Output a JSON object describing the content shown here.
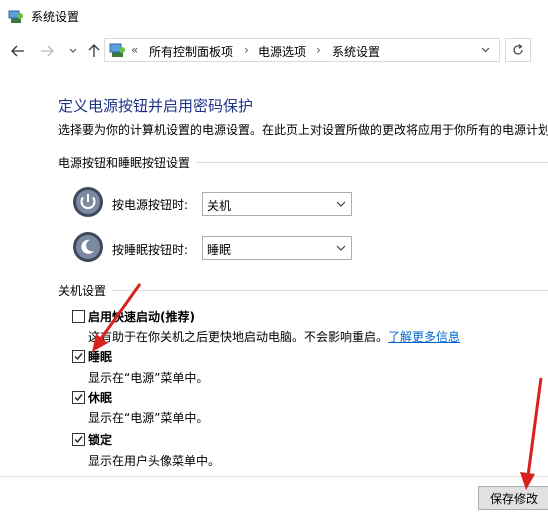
{
  "window": {
    "title": "系统设置"
  },
  "nav": {
    "back_icon": "back-arrow-icon",
    "forward_icon": "forward-arrow-icon",
    "recent_icon": "chevron-down-icon",
    "up_icon": "up-arrow-icon",
    "breadcrumb_prefix": "«",
    "breadcrumbs": [
      "所有控制面板项",
      "电源选项",
      "系统设置"
    ],
    "separator": "›",
    "refresh_icon": "refresh-icon"
  },
  "main": {
    "heading": "定义电源按钮并启用密码保护",
    "description": "选择要为你的计算机设置的电源设置。在此页上对设置所做的更改将应用于你所有的电源计划",
    "buttons_section": {
      "title": "电源按钮和睡眠按钮设置",
      "power_label": "按电源按钮时:",
      "power_value": "关机",
      "sleep_label": "按睡眠按钮时:",
      "sleep_value": "睡眠"
    },
    "shutdown_section": {
      "title": "关机设置",
      "items": [
        {
          "label": "启用快速启动(推荐)",
          "checked": false,
          "desc_text": "这有助于在你关机之后更快地启动电脑。不会影响重启。",
          "desc_link": "了解更多信息"
        },
        {
          "label": "睡眠",
          "checked": true,
          "desc_text": "显示在“电源”菜单中。"
        },
        {
          "label": "休眠",
          "checked": true,
          "desc_text": "显示在“电源”菜单中。"
        },
        {
          "label": "锁定",
          "checked": true,
          "desc_text": "显示在用户头像菜单中。"
        }
      ]
    }
  },
  "footer": {
    "save_label": "保存修改"
  },
  "colors": {
    "heading": "#1e3287",
    "link": "#0066cc",
    "annotation_arrow": "#d9211e"
  }
}
